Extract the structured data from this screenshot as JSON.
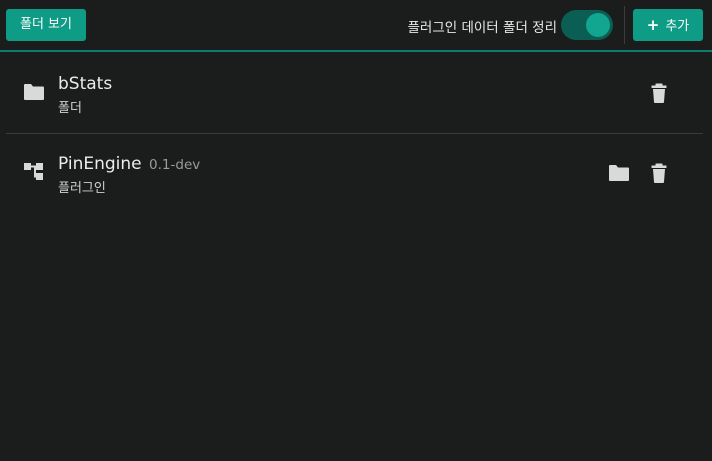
{
  "toolbar": {
    "open_folder_label": "폴더 보기",
    "cleanup_label": "플러그인 데이터 폴더 정리",
    "cleanup_enabled": true,
    "add_label": "추가",
    "add_icon": "plus-icon"
  },
  "items": [
    {
      "title": "bStats",
      "version": "",
      "subtitle": "폴더",
      "icon": "folder-icon",
      "actions": [
        "trash-icon"
      ]
    },
    {
      "title": "PinEngine",
      "version": "0.1-dev",
      "subtitle": "플러그인",
      "icon": "plugin-tree-icon",
      "actions": [
        "folder-icon",
        "trash-icon"
      ]
    }
  ],
  "colors": {
    "background": "#1b1c1c",
    "accent": "#0f9c86",
    "toggle_track": "#0a5e53",
    "divider": "#3a3b3b"
  }
}
